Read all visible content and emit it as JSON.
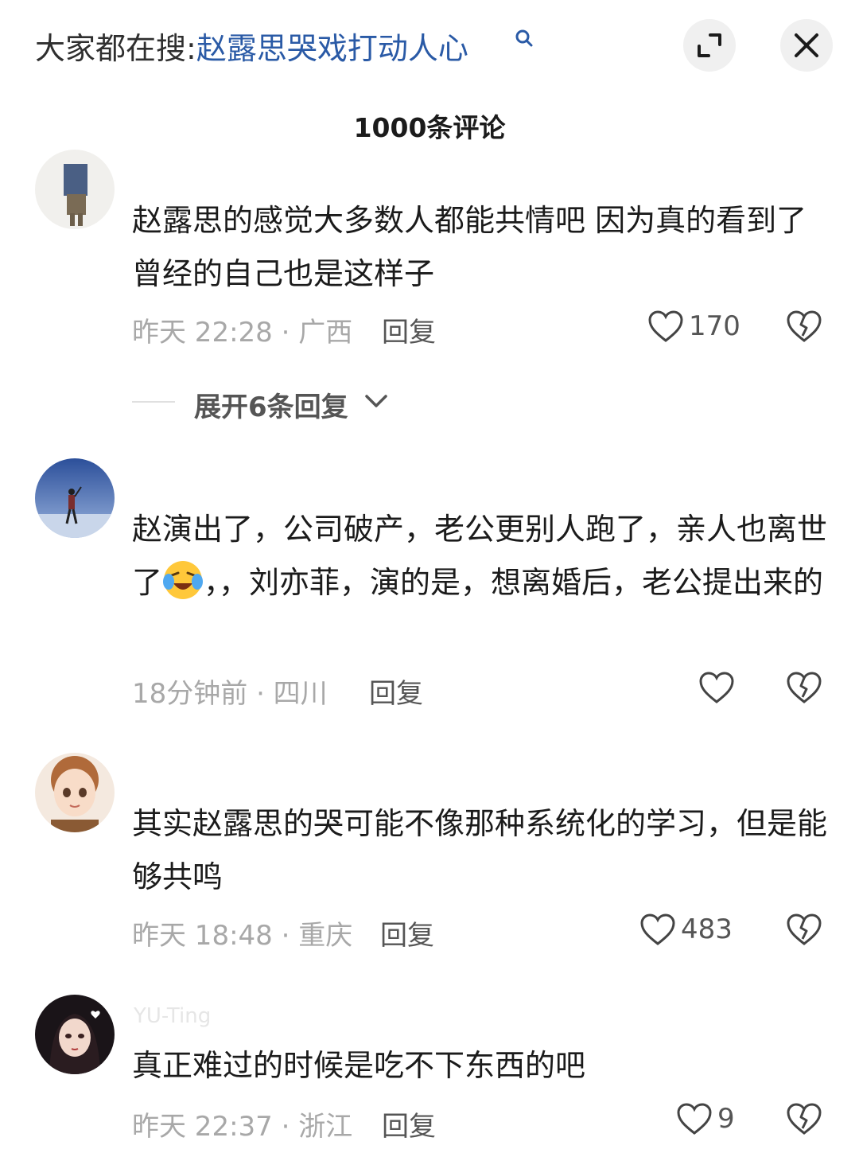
{
  "header": {
    "search_prefix": "大家都在搜:",
    "search_query": "赵露思哭戏打动人心",
    "comments_count": "1000条评论"
  },
  "comments": [
    {
      "username": "",
      "text": "赵露思的感觉大多数人都能共情吧 因为真的看到了曾经的自己也是这样子",
      "meta": "昨天 22:28 · 广西",
      "reply_label": "回复",
      "likes": "170",
      "expand_label": "展开6条回复"
    },
    {
      "username": "",
      "text_part1": "赵演出了，公司破产，老公更别人跑了，亲人也离世了",
      "text_part2": "，，刘亦菲，演的是，想离婚后，老公提出来的",
      "meta": "18分钟前 · 四川",
      "reply_label": "回复",
      "likes": ""
    },
    {
      "username": "",
      "text": "其实赵露思的哭可能不像那种系统化的学习，但是能够共鸣",
      "meta": "昨天 18:48 · 重庆",
      "reply_label": "回复",
      "likes": "483"
    },
    {
      "username": "YU-Ting",
      "text": "真正难过的时候是吃不下东西的吧",
      "meta": "昨天 22:37 · 浙江",
      "reply_label": "回复",
      "likes": "9"
    }
  ]
}
